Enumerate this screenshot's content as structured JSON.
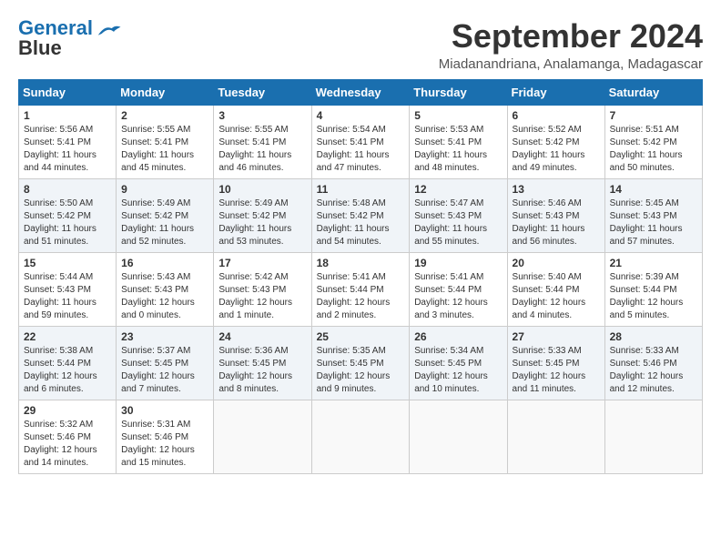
{
  "header": {
    "logo_line1": "General",
    "logo_line2": "Blue",
    "month_title": "September 2024",
    "location": "Miadanandriana, Analamanga, Madagascar"
  },
  "weekdays": [
    "Sunday",
    "Monday",
    "Tuesday",
    "Wednesday",
    "Thursday",
    "Friday",
    "Saturday"
  ],
  "days": [
    {
      "date": 1,
      "row": 0,
      "col": 0,
      "sunrise": "5:56 AM",
      "sunset": "5:41 PM",
      "daylight": "11 hours and 44 minutes."
    },
    {
      "date": 2,
      "row": 0,
      "col": 1,
      "sunrise": "5:55 AM",
      "sunset": "5:41 PM",
      "daylight": "11 hours and 45 minutes."
    },
    {
      "date": 3,
      "row": 0,
      "col": 2,
      "sunrise": "5:55 AM",
      "sunset": "5:41 PM",
      "daylight": "11 hours and 46 minutes."
    },
    {
      "date": 4,
      "row": 0,
      "col": 3,
      "sunrise": "5:54 AM",
      "sunset": "5:41 PM",
      "daylight": "11 hours and 47 minutes."
    },
    {
      "date": 5,
      "row": 0,
      "col": 4,
      "sunrise": "5:53 AM",
      "sunset": "5:41 PM",
      "daylight": "11 hours and 48 minutes."
    },
    {
      "date": 6,
      "row": 0,
      "col": 5,
      "sunrise": "5:52 AM",
      "sunset": "5:42 PM",
      "daylight": "11 hours and 49 minutes."
    },
    {
      "date": 7,
      "row": 0,
      "col": 6,
      "sunrise": "5:51 AM",
      "sunset": "5:42 PM",
      "daylight": "11 hours and 50 minutes."
    },
    {
      "date": 8,
      "row": 1,
      "col": 0,
      "sunrise": "5:50 AM",
      "sunset": "5:42 PM",
      "daylight": "11 hours and 51 minutes."
    },
    {
      "date": 9,
      "row": 1,
      "col": 1,
      "sunrise": "5:49 AM",
      "sunset": "5:42 PM",
      "daylight": "11 hours and 52 minutes."
    },
    {
      "date": 10,
      "row": 1,
      "col": 2,
      "sunrise": "5:49 AM",
      "sunset": "5:42 PM",
      "daylight": "11 hours and 53 minutes."
    },
    {
      "date": 11,
      "row": 1,
      "col": 3,
      "sunrise": "5:48 AM",
      "sunset": "5:42 PM",
      "daylight": "11 hours and 54 minutes."
    },
    {
      "date": 12,
      "row": 1,
      "col": 4,
      "sunrise": "5:47 AM",
      "sunset": "5:43 PM",
      "daylight": "11 hours and 55 minutes."
    },
    {
      "date": 13,
      "row": 1,
      "col": 5,
      "sunrise": "5:46 AM",
      "sunset": "5:43 PM",
      "daylight": "11 hours and 56 minutes."
    },
    {
      "date": 14,
      "row": 1,
      "col": 6,
      "sunrise": "5:45 AM",
      "sunset": "5:43 PM",
      "daylight": "11 hours and 57 minutes."
    },
    {
      "date": 15,
      "row": 2,
      "col": 0,
      "sunrise": "5:44 AM",
      "sunset": "5:43 PM",
      "daylight": "11 hours and 59 minutes."
    },
    {
      "date": 16,
      "row": 2,
      "col": 1,
      "sunrise": "5:43 AM",
      "sunset": "5:43 PM",
      "daylight": "12 hours and 0 minutes."
    },
    {
      "date": 17,
      "row": 2,
      "col": 2,
      "sunrise": "5:42 AM",
      "sunset": "5:43 PM",
      "daylight": "12 hours and 1 minute."
    },
    {
      "date": 18,
      "row": 2,
      "col": 3,
      "sunrise": "5:41 AM",
      "sunset": "5:44 PM",
      "daylight": "12 hours and 2 minutes."
    },
    {
      "date": 19,
      "row": 2,
      "col": 4,
      "sunrise": "5:41 AM",
      "sunset": "5:44 PM",
      "daylight": "12 hours and 3 minutes."
    },
    {
      "date": 20,
      "row": 2,
      "col": 5,
      "sunrise": "5:40 AM",
      "sunset": "5:44 PM",
      "daylight": "12 hours and 4 minutes."
    },
    {
      "date": 21,
      "row": 2,
      "col": 6,
      "sunrise": "5:39 AM",
      "sunset": "5:44 PM",
      "daylight": "12 hours and 5 minutes."
    },
    {
      "date": 22,
      "row": 3,
      "col": 0,
      "sunrise": "5:38 AM",
      "sunset": "5:44 PM",
      "daylight": "12 hours and 6 minutes."
    },
    {
      "date": 23,
      "row": 3,
      "col": 1,
      "sunrise": "5:37 AM",
      "sunset": "5:45 PM",
      "daylight": "12 hours and 7 minutes."
    },
    {
      "date": 24,
      "row": 3,
      "col": 2,
      "sunrise": "5:36 AM",
      "sunset": "5:45 PM",
      "daylight": "12 hours and 8 minutes."
    },
    {
      "date": 25,
      "row": 3,
      "col": 3,
      "sunrise": "5:35 AM",
      "sunset": "5:45 PM",
      "daylight": "12 hours and 9 minutes."
    },
    {
      "date": 26,
      "row": 3,
      "col": 4,
      "sunrise": "5:34 AM",
      "sunset": "5:45 PM",
      "daylight": "12 hours and 10 minutes."
    },
    {
      "date": 27,
      "row": 3,
      "col": 5,
      "sunrise": "5:33 AM",
      "sunset": "5:45 PM",
      "daylight": "12 hours and 11 minutes."
    },
    {
      "date": 28,
      "row": 3,
      "col": 6,
      "sunrise": "5:33 AM",
      "sunset": "5:46 PM",
      "daylight": "12 hours and 12 minutes."
    },
    {
      "date": 29,
      "row": 4,
      "col": 0,
      "sunrise": "5:32 AM",
      "sunset": "5:46 PM",
      "daylight": "12 hours and 14 minutes."
    },
    {
      "date": 30,
      "row": 4,
      "col": 1,
      "sunrise": "5:31 AM",
      "sunset": "5:46 PM",
      "daylight": "12 hours and 15 minutes."
    }
  ],
  "labels": {
    "sunrise": "Sunrise:",
    "sunset": "Sunset:",
    "daylight": "Daylight:"
  }
}
